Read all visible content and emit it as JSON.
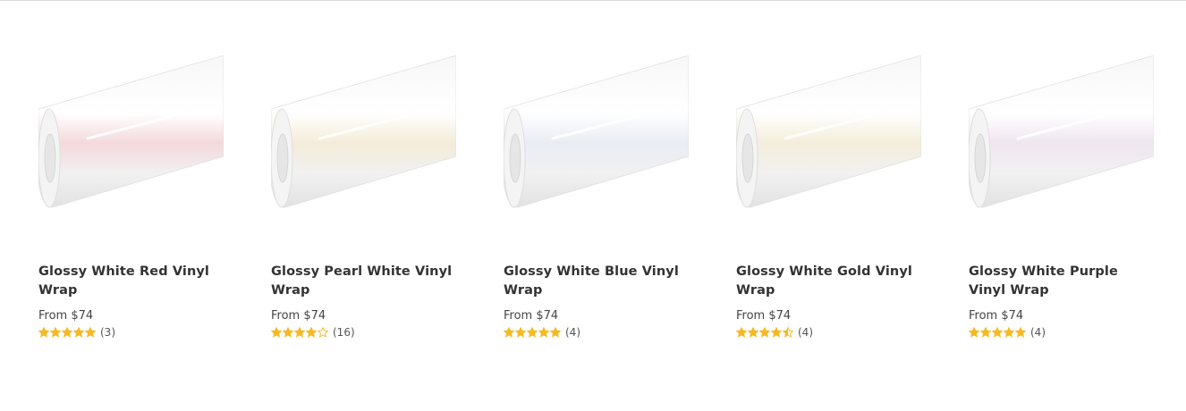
{
  "products": [
    {
      "title": "Glossy White Red Vinyl Wrap",
      "price": "From $74",
      "rating": 5,
      "reviews": "(3)",
      "image_icon": "vinyl-roll-image",
      "tint": "#f3d9dc"
    },
    {
      "title": "Glossy Pearl White Vinyl Wrap",
      "price": "From $74",
      "rating": 4,
      "reviews": "(16)",
      "image_icon": "vinyl-roll-image",
      "tint": "#f4ecd9"
    },
    {
      "title": "Glossy White Blue Vinyl Wrap",
      "price": "From $74",
      "rating": 5,
      "reviews": "(4)",
      "image_icon": "vinyl-roll-image",
      "tint": "#e9ecf4"
    },
    {
      "title": "Glossy White Gold Vinyl Wrap",
      "price": "From $74",
      "rating": 4.5,
      "reviews": "(4)",
      "image_icon": "vinyl-roll-image",
      "tint": "#f3edda"
    },
    {
      "title": "Glossy White Purple Vinyl Wrap",
      "price": "From $74",
      "rating": 5,
      "reviews": "(4)",
      "image_icon": "vinyl-roll-image",
      "tint": "#efe6f0"
    }
  ],
  "colors": {
    "star": "#f5b921",
    "star_empty_stroke": "#f5b921"
  }
}
